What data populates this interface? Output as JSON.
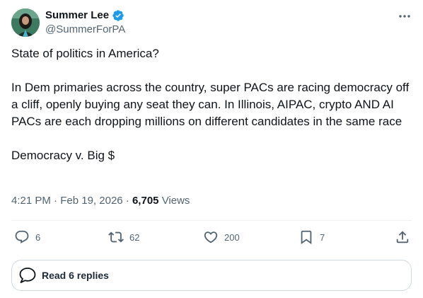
{
  "author": {
    "display_name": "Summer Lee",
    "handle": "@SummerForPA",
    "verified": true,
    "avatar_bg": "#2f6f5b"
  },
  "tweet": {
    "paragraphs": [
      "State of politics in America?",
      "In Dem primaries across the country, super PACs are racing democracy off a cliff, openly buying any seat they can. In Illinois, AIPAC, crypto AND AI PACs are each dropping millions on different candidates in the same race",
      "Democracy v. Big $"
    ]
  },
  "meta": {
    "time": "4:21 PM",
    "separator": "·",
    "date": "Feb 19, 2026",
    "views_count": "6,705",
    "views_label": "Views"
  },
  "actions": {
    "replies": "6",
    "reposts": "62",
    "likes": "200",
    "bookmarks": "7"
  },
  "read_replies_label": "Read 6 replies",
  "colors": {
    "verified_badge": "#1d9bf0",
    "secondary_text": "#536471",
    "divider": "#eff3f4"
  }
}
